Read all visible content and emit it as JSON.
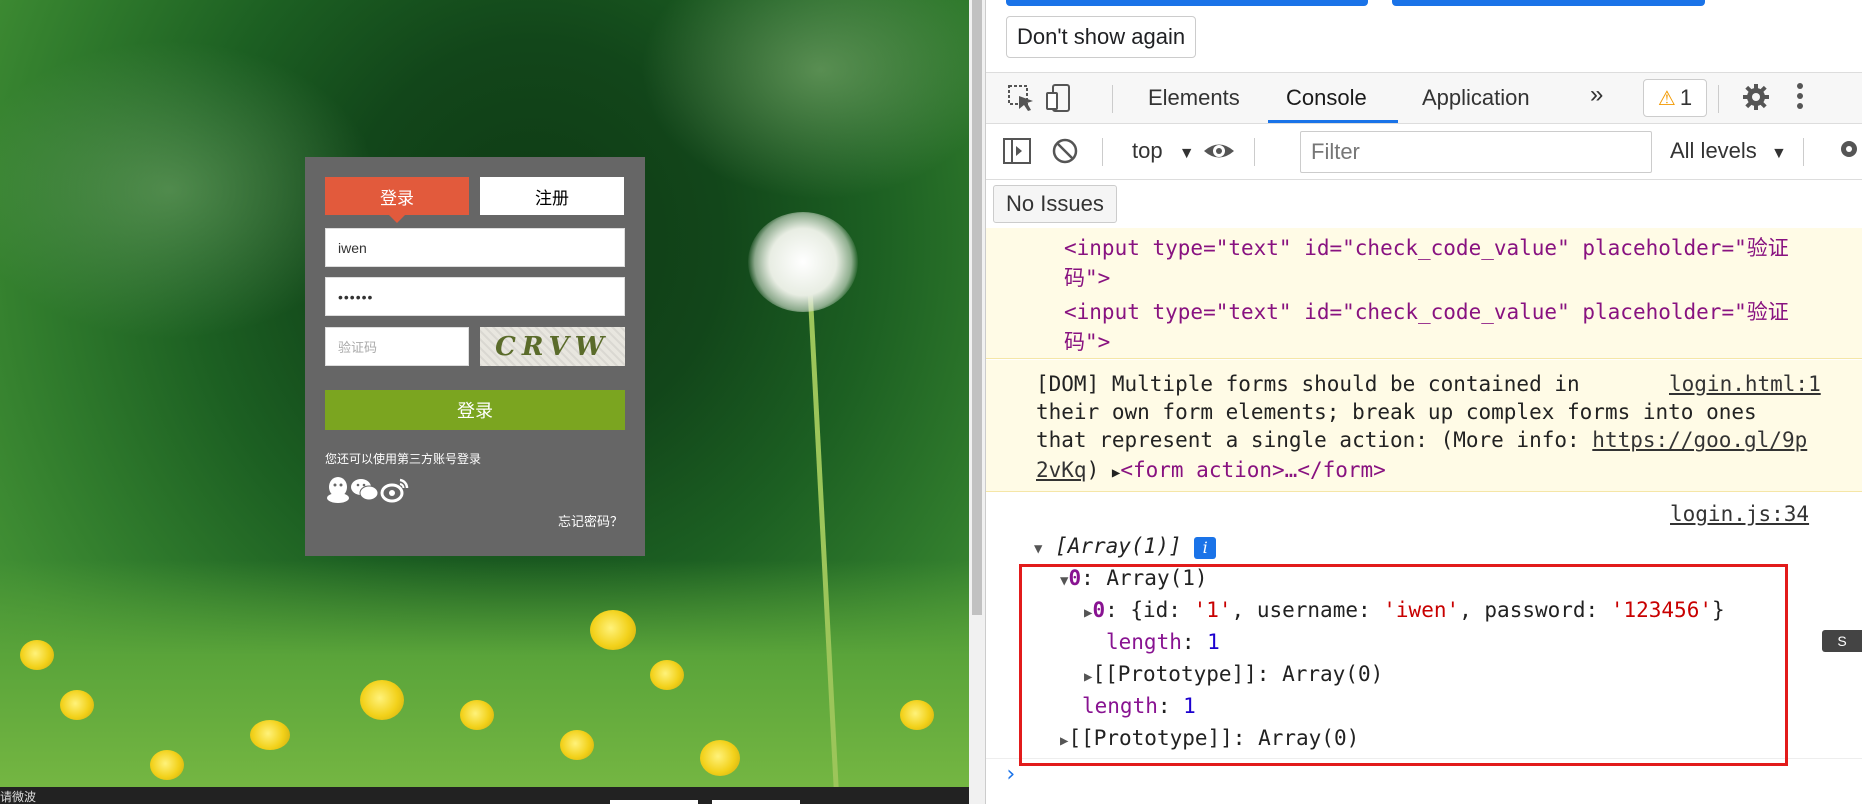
{
  "login_page": {
    "tabs": {
      "login": "登录",
      "register": "注册"
    },
    "username_value": "iwen",
    "password_value": "••••••",
    "captcha_placeholder": "验证码",
    "captcha_text": "CRVW",
    "submit_label": "登录",
    "third_party_text": "您还可以使用第三方账号登录",
    "social_icons": [
      "qq-icon",
      "wechat-icon",
      "weibo-icon"
    ],
    "forgot_password": "忘记密码？",
    "status_text": "请微波"
  },
  "devtools": {
    "dont_show_again": "Don't show again",
    "tabs": {
      "elements": "Elements",
      "console": "Console",
      "application": "Application",
      "more": "»"
    },
    "warning_count": "1",
    "context": "top",
    "filter_placeholder": "Filter",
    "levels": "All levels",
    "no_issues": "No Issues",
    "warnings": {
      "input_line1_a": "<input type=\"text\" id=\"check_code_value\" placeholder=\"验证",
      "input_line1_b": "码\">",
      "input_line2_a": "<input type=\"text\" id=\"check_code_value\" placeholder=\"验证",
      "input_line2_b": "码\">",
      "dom_line1": "[DOM] Multiple forms should be contained in",
      "dom_source": "login.html:1",
      "dom_line2": "their own form elements; break up complex forms into ones",
      "dom_line3_a": "that represent a single action: (More info: ",
      "dom_link_a": "https://goo.gl/9p",
      "dom_link_b": "2vKq",
      "dom_line4_b": ") ",
      "dom_form": "<form action>…</form>"
    },
    "log": {
      "source": "login.js:34",
      "array_header": "[Array(1)]",
      "info_icon": "i",
      "row0": "0: Array(1)",
      "row0_key": "0",
      "row0_val": ": Array(1)",
      "row00_key": "0",
      "row00_obj_a": ": {id: ",
      "row00_id": "'1'",
      "row00_obj_b": ", username: ",
      "row00_user": "'iwen'",
      "row00_obj_c": ", password: ",
      "row00_pass": "'123456'",
      "row00_obj_d": "}",
      "inner_length_key": "length",
      "inner_length_val": "1",
      "inner_proto": "[[Prototype]]: Array(0)",
      "outer_length_key": "length",
      "outer_length_val": "1",
      "outer_proto": "[[Prototype]]: Array(0)"
    },
    "prompt": "›",
    "side_badge": "S"
  }
}
